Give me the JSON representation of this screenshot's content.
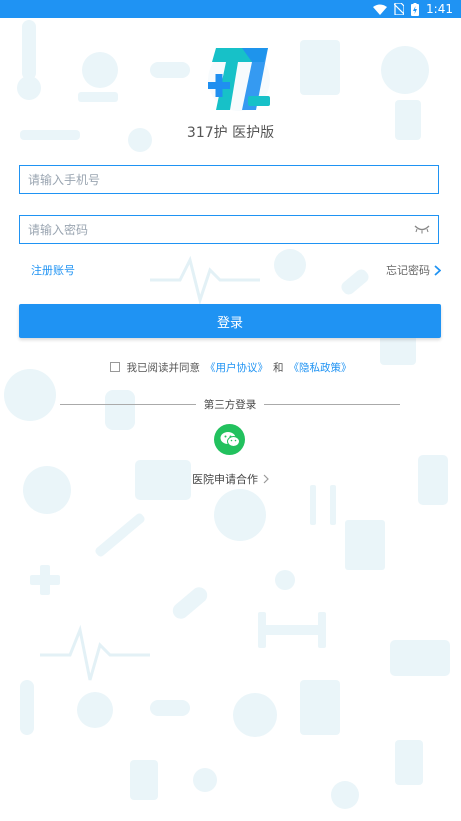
{
  "status_bar": {
    "time": "1:41"
  },
  "app": {
    "name": "317护 医护版",
    "logo_text": "317",
    "logo_badge": "医护版"
  },
  "phone_field": {
    "placeholder": "请输入手机号"
  },
  "password_field": {
    "placeholder": "请输入密码"
  },
  "links": {
    "register": "注册账号",
    "forgot": "忘记密码"
  },
  "login_button": {
    "label": "登录"
  },
  "agreement": {
    "prefix": "我已阅读并同意",
    "user_agreement": "《用户协议》",
    "and": "和",
    "privacy_policy": "《隐私政策》"
  },
  "third_party": {
    "label": "第三方登录"
  },
  "hospital_link": {
    "label": "医院申请合作"
  },
  "colors": {
    "accent": "#1f93f3",
    "wechat": "#22c15e",
    "logo_teal": "#17c1c8",
    "logo_blue": "#1f8ff0",
    "pattern": "#e9f5f9"
  }
}
